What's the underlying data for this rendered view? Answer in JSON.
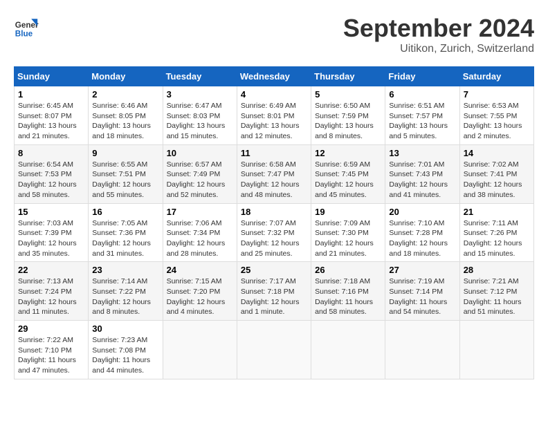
{
  "logo": {
    "line1": "General",
    "line2": "Blue"
  },
  "title": "September 2024",
  "location": "Uitikon, Zurich, Switzerland",
  "weekdays": [
    "Sunday",
    "Monday",
    "Tuesday",
    "Wednesday",
    "Thursday",
    "Friday",
    "Saturday"
  ],
  "weeks": [
    [
      {
        "day": "1",
        "info": "Sunrise: 6:45 AM\nSunset: 8:07 PM\nDaylight: 13 hours\nand 21 minutes."
      },
      {
        "day": "2",
        "info": "Sunrise: 6:46 AM\nSunset: 8:05 PM\nDaylight: 13 hours\nand 18 minutes."
      },
      {
        "day": "3",
        "info": "Sunrise: 6:47 AM\nSunset: 8:03 PM\nDaylight: 13 hours\nand 15 minutes."
      },
      {
        "day": "4",
        "info": "Sunrise: 6:49 AM\nSunset: 8:01 PM\nDaylight: 13 hours\nand 12 minutes."
      },
      {
        "day": "5",
        "info": "Sunrise: 6:50 AM\nSunset: 7:59 PM\nDaylight: 13 hours\nand 8 minutes."
      },
      {
        "day": "6",
        "info": "Sunrise: 6:51 AM\nSunset: 7:57 PM\nDaylight: 13 hours\nand 5 minutes."
      },
      {
        "day": "7",
        "info": "Sunrise: 6:53 AM\nSunset: 7:55 PM\nDaylight: 13 hours\nand 2 minutes."
      }
    ],
    [
      {
        "day": "8",
        "info": "Sunrise: 6:54 AM\nSunset: 7:53 PM\nDaylight: 12 hours\nand 58 minutes."
      },
      {
        "day": "9",
        "info": "Sunrise: 6:55 AM\nSunset: 7:51 PM\nDaylight: 12 hours\nand 55 minutes."
      },
      {
        "day": "10",
        "info": "Sunrise: 6:57 AM\nSunset: 7:49 PM\nDaylight: 12 hours\nand 52 minutes."
      },
      {
        "day": "11",
        "info": "Sunrise: 6:58 AM\nSunset: 7:47 PM\nDaylight: 12 hours\nand 48 minutes."
      },
      {
        "day": "12",
        "info": "Sunrise: 6:59 AM\nSunset: 7:45 PM\nDaylight: 12 hours\nand 45 minutes."
      },
      {
        "day": "13",
        "info": "Sunrise: 7:01 AM\nSunset: 7:43 PM\nDaylight: 12 hours\nand 41 minutes."
      },
      {
        "day": "14",
        "info": "Sunrise: 7:02 AM\nSunset: 7:41 PM\nDaylight: 12 hours\nand 38 minutes."
      }
    ],
    [
      {
        "day": "15",
        "info": "Sunrise: 7:03 AM\nSunset: 7:39 PM\nDaylight: 12 hours\nand 35 minutes."
      },
      {
        "day": "16",
        "info": "Sunrise: 7:05 AM\nSunset: 7:36 PM\nDaylight: 12 hours\nand 31 minutes."
      },
      {
        "day": "17",
        "info": "Sunrise: 7:06 AM\nSunset: 7:34 PM\nDaylight: 12 hours\nand 28 minutes."
      },
      {
        "day": "18",
        "info": "Sunrise: 7:07 AM\nSunset: 7:32 PM\nDaylight: 12 hours\nand 25 minutes."
      },
      {
        "day": "19",
        "info": "Sunrise: 7:09 AM\nSunset: 7:30 PM\nDaylight: 12 hours\nand 21 minutes."
      },
      {
        "day": "20",
        "info": "Sunrise: 7:10 AM\nSunset: 7:28 PM\nDaylight: 12 hours\nand 18 minutes."
      },
      {
        "day": "21",
        "info": "Sunrise: 7:11 AM\nSunset: 7:26 PM\nDaylight: 12 hours\nand 15 minutes."
      }
    ],
    [
      {
        "day": "22",
        "info": "Sunrise: 7:13 AM\nSunset: 7:24 PM\nDaylight: 12 hours\nand 11 minutes."
      },
      {
        "day": "23",
        "info": "Sunrise: 7:14 AM\nSunset: 7:22 PM\nDaylight: 12 hours\nand 8 minutes."
      },
      {
        "day": "24",
        "info": "Sunrise: 7:15 AM\nSunset: 7:20 PM\nDaylight: 12 hours\nand 4 minutes."
      },
      {
        "day": "25",
        "info": "Sunrise: 7:17 AM\nSunset: 7:18 PM\nDaylight: 12 hours\nand 1 minute."
      },
      {
        "day": "26",
        "info": "Sunrise: 7:18 AM\nSunset: 7:16 PM\nDaylight: 11 hours\nand 58 minutes."
      },
      {
        "day": "27",
        "info": "Sunrise: 7:19 AM\nSunset: 7:14 PM\nDaylight: 11 hours\nand 54 minutes."
      },
      {
        "day": "28",
        "info": "Sunrise: 7:21 AM\nSunset: 7:12 PM\nDaylight: 11 hours\nand 51 minutes."
      }
    ],
    [
      {
        "day": "29",
        "info": "Sunrise: 7:22 AM\nSunset: 7:10 PM\nDaylight: 11 hours\nand 47 minutes."
      },
      {
        "day": "30",
        "info": "Sunrise: 7:23 AM\nSunset: 7:08 PM\nDaylight: 11 hours\nand 44 minutes."
      },
      {
        "day": "",
        "info": ""
      },
      {
        "day": "",
        "info": ""
      },
      {
        "day": "",
        "info": ""
      },
      {
        "day": "",
        "info": ""
      },
      {
        "day": "",
        "info": ""
      }
    ]
  ]
}
